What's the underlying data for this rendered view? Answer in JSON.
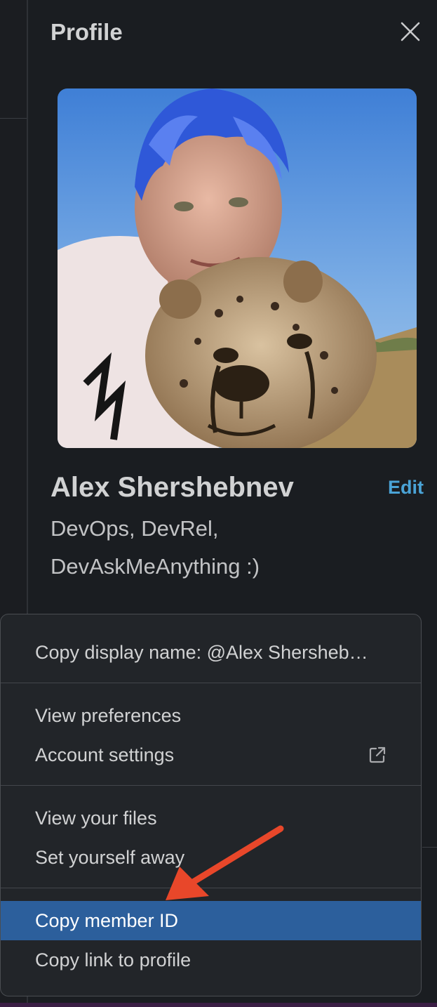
{
  "panel": {
    "title": "Profile"
  },
  "profile": {
    "full_name": "Alex Shershebnev",
    "edit_label": "Edit",
    "title": "DevOps, DevRel, DevAskMeAnything :)"
  },
  "menu": {
    "group1": [
      {
        "label": "Copy display name: @Alex Shersheb…"
      }
    ],
    "group2": [
      {
        "label": "View preferences"
      },
      {
        "label": "Account settings"
      }
    ],
    "group3": [
      {
        "label": "View your files"
      },
      {
        "label": "Set yourself away"
      }
    ],
    "group4": [
      {
        "label": "Copy member ID",
        "highlighted": true
      },
      {
        "label": "Copy link to profile"
      }
    ]
  },
  "colors": {
    "background": "#1a1d21",
    "menu_bg": "#222529",
    "highlight": "#2c5f9c",
    "link": "#4aa3d6",
    "annotation_arrow": "#e8472a"
  },
  "icons": {
    "close": "close-icon",
    "external_link": "external-link-icon"
  }
}
